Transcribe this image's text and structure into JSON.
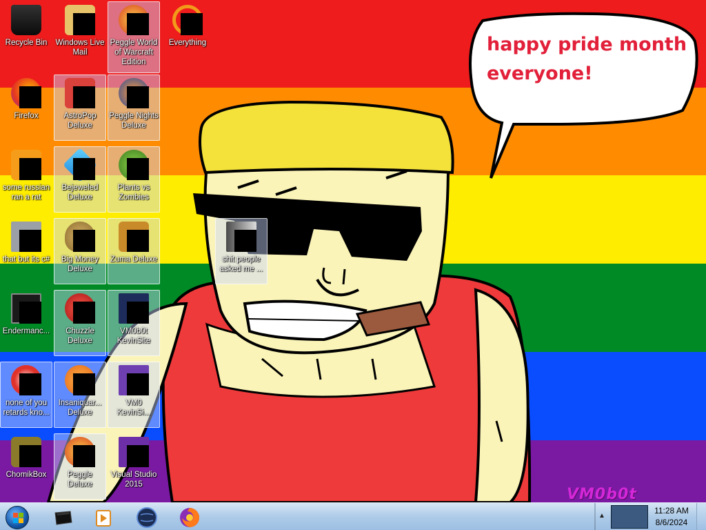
{
  "wallpaper": {
    "speech_bubble": [
      "happy pride month",
      "everyone!"
    ],
    "signature": "VM0b0t",
    "colors": [
      "#ee1c1c",
      "#ff8c00",
      "#ffed00",
      "#008a26",
      "#0a4dff",
      "#7a1aa3"
    ]
  },
  "desktop": {
    "icons": [
      {
        "label": "Recycle Bin"
      },
      {
        "label": "Windows Live Mail"
      },
      {
        "label": "Peggle World of Warcraft Edition"
      },
      {
        "label": "Everything"
      },
      {
        "label": "Firefox"
      },
      {
        "label": "AstroPop Deluxe"
      },
      {
        "label": "Peggle Nights Deluxe"
      },
      {
        "label": "some russian ran a rat"
      },
      {
        "label": "Bejeweled Deluxe"
      },
      {
        "label": "Plants vs Zombies"
      },
      {
        "label": "that but its c#"
      },
      {
        "label": "Big Money Deluxe"
      },
      {
        "label": "Zuma Deluxe"
      },
      {
        "label": "shit people asked me ..."
      },
      {
        "label": "Endermanc..."
      },
      {
        "label": "Chuzzle Deluxe"
      },
      {
        "label": "VM0b0t KevinSite"
      },
      {
        "label": "none of you retards kno..."
      },
      {
        "label": "Insaniquar... Deluxe"
      },
      {
        "label": "VM0 KevinSi..."
      },
      {
        "label": "ChomikBox"
      },
      {
        "label": "Peggle Deluxe"
      },
      {
        "label": "Visual Studio 2015"
      }
    ]
  },
  "taskbar": {
    "start_icon": "windows-start-orb",
    "pinned": [
      "file-explorer-icon",
      "media-player-icon",
      "globe-icon",
      "firefox-icon"
    ],
    "clock": {
      "time": "11:28 AM",
      "date": "8/6/2024"
    }
  }
}
